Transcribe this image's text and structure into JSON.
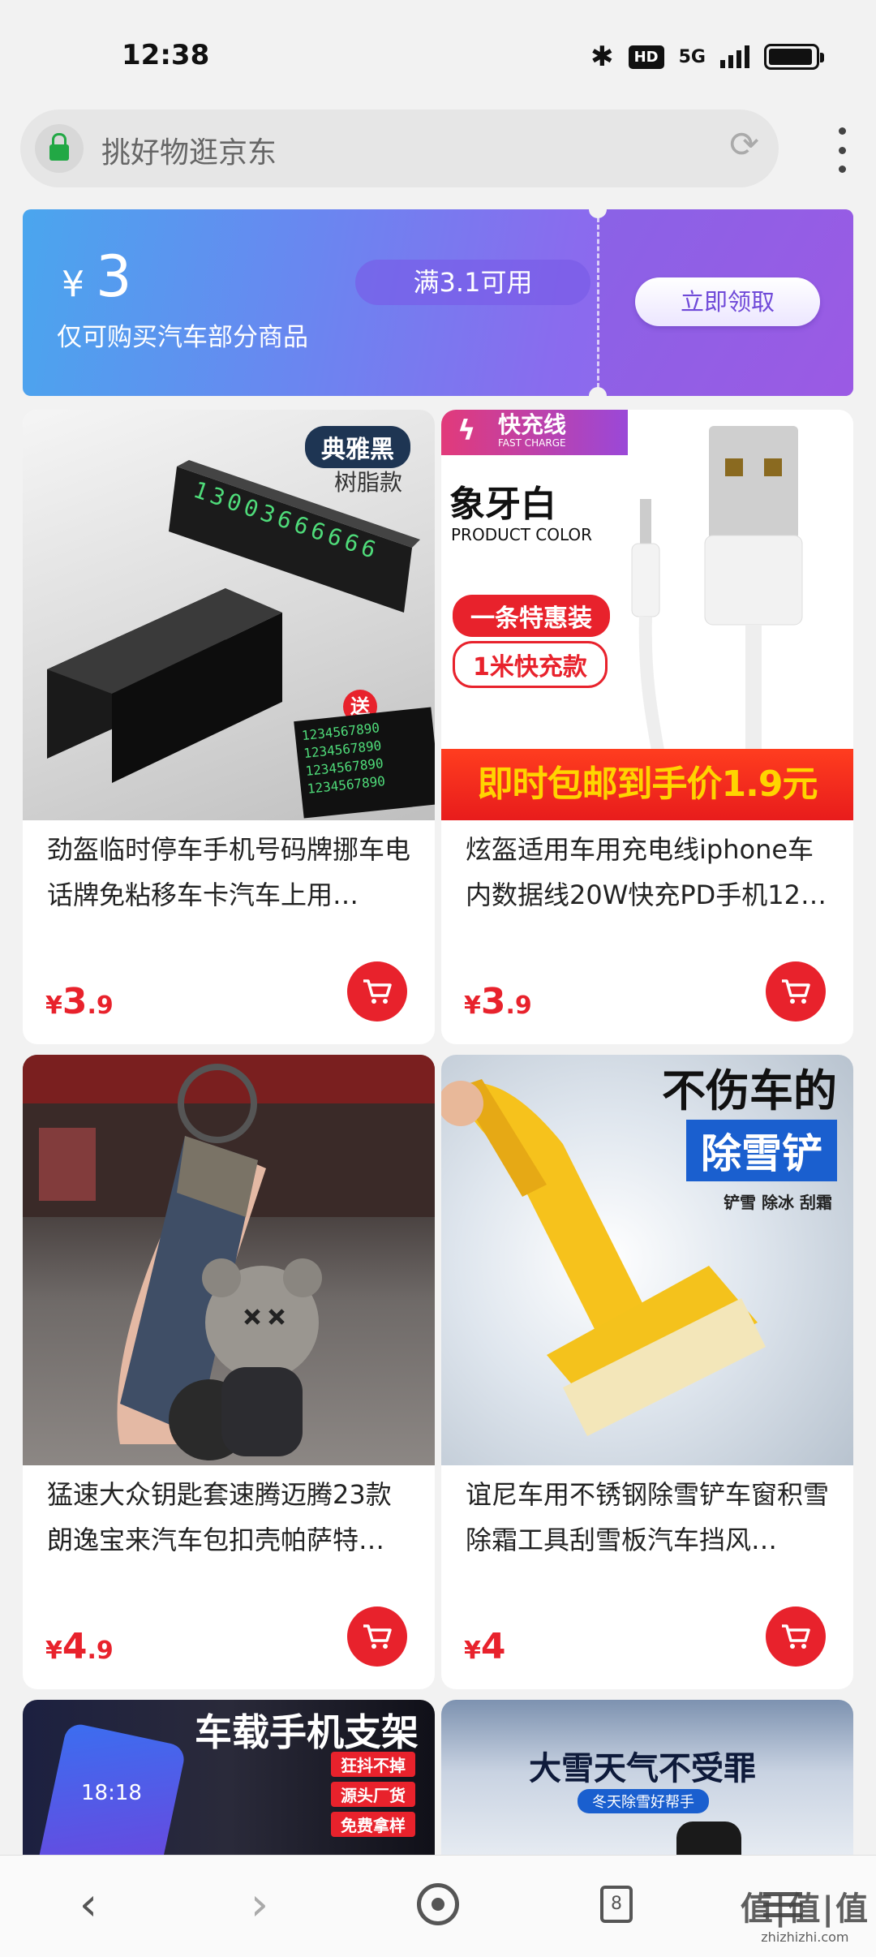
{
  "status_bar": {
    "time": "12:38",
    "network": "5G",
    "bluetooth_icon": "bluetooth-icon",
    "hd_label": "HD",
    "battery_level": 0.95
  },
  "search": {
    "text": "挑好物逛京东"
  },
  "coupon": {
    "currency": "¥",
    "amount": "3",
    "description": "仅可购买汽车部分商品",
    "condition": "满3.1可用",
    "button_label": "立即领取",
    "colors": {
      "start": "#4aa6ee",
      "end": "#9a5fe8"
    }
  },
  "products": [
    {
      "title": "劲盔临时停车手机号码牌挪车电话牌免粘移车卡汽车上用…",
      "price_symbol": "¥",
      "price_int": "3",
      "price_dec": ".9",
      "image": {
        "tag": "典雅黑",
        "sub_tag": "树脂款",
        "display_digits": "13003666666",
        "gift_label": "送"
      }
    },
    {
      "title": "炫盔适用车用充电线iphone车内数据线20W快充PD手机12…",
      "price_symbol": "¥",
      "price_int": "3",
      "price_dec": ".9",
      "image": {
        "badge": "快充线",
        "badge_en": "FAST CHARGE",
        "color_name": "象牙白",
        "color_en": "PRODUCT COLOR",
        "pill_1": "一条特惠装",
        "pill_2": "1米快充款",
        "promo": "即时包邮到手价1.9元"
      }
    },
    {
      "title": "猛速大众钥匙套速腾迈腾23款朗逸宝来汽车包扣壳帕萨特…",
      "price_symbol": "¥",
      "price_int": "4",
      "price_dec": ".9",
      "image": {}
    },
    {
      "title": "谊尼车用不锈钢除雪铲车窗积雪除霜工具刮雪板汽车挡风…",
      "price_symbol": "¥",
      "price_int": "4",
      "price_dec": "",
      "image": {
        "headline": "不伤车的",
        "headline_blue": "除雪铲",
        "headline_small": "铲雪 除冰 刮霜"
      }
    }
  ],
  "partial_products": [
    {
      "title": "车载手机支架",
      "tags": [
        "狂抖不掉",
        "源头厂货",
        "免费拿样"
      ],
      "phone_time": "18:18"
    },
    {
      "title": "大雪天气不受罪",
      "subtitle": "冬天除雪好帮手"
    }
  ],
  "bottom_nav": {
    "tab_count": "8",
    "items": [
      "back-icon",
      "forward-icon",
      "home-icon",
      "tabs-icon",
      "menu-icon"
    ]
  },
  "watermark": {
    "big": "值|值|值",
    "small": "zhizhizhi.com"
  },
  "colors": {
    "price_red": "#e8222c",
    "page_bg": "#f2f2f2"
  }
}
